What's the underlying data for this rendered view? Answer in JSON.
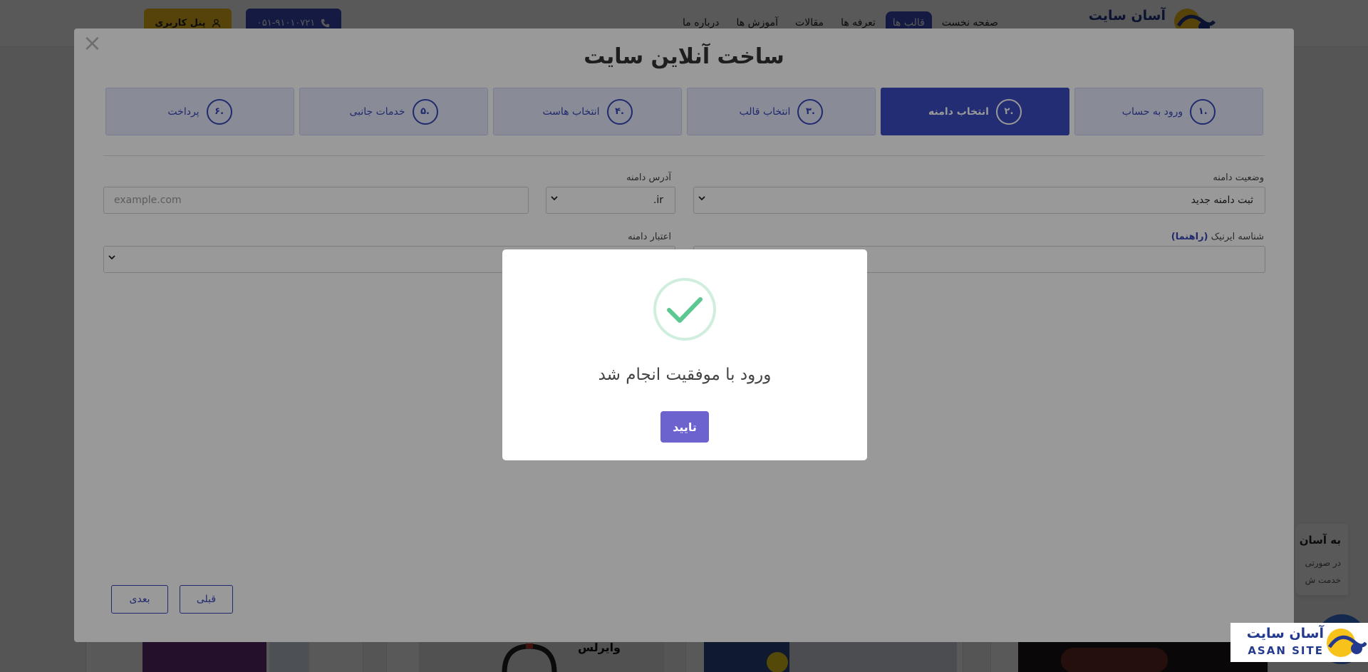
{
  "header": {
    "logo_text": "آسان سایت",
    "nav": [
      "صفحه نخست",
      "قالب ها",
      "تعرفه ها",
      "مقالات",
      "آموزش ها",
      "درباره ما"
    ],
    "active_nav_index": 1,
    "phone": "۰۵۱-۹۱۰۱۰۷۲۱",
    "panel_label": "پنل کاربری"
  },
  "bg_cards": {
    "headphones_caption": "وایرلس"
  },
  "chat_widget": {
    "title": "به آسان",
    "line1": "در صورتی",
    "line2": "خدمت ش"
  },
  "wizard": {
    "close_symbol": "×",
    "title": "ساخت آنلاین سایت",
    "steps": [
      {
        "num": "۱.",
        "label": "ورود به حساب",
        "active": false
      },
      {
        "num": "۲.",
        "label": "انتخاب دامنه",
        "active": true
      },
      {
        "num": "۳.",
        "label": "انتخاب قالب",
        "active": false
      },
      {
        "num": "۴.",
        "label": "انتخاب هاست",
        "active": false
      },
      {
        "num": "۵.",
        "label": "خدمات جانبی",
        "active": false
      },
      {
        "num": "۶.",
        "label": "پرداخت",
        "active": false
      }
    ],
    "form": {
      "domain_status_label": "وضعیت دامنه",
      "domain_status_value": "ثبت دامنه جدید",
      "domain_address_label": "آدرس دامنه",
      "tld_value": ".ir",
      "domain_placeholder": "example.com",
      "irnic_label": "شناسه ایرنیک",
      "irnic_link": "(راهنما)",
      "validity_label": "اعتبار دامنه"
    },
    "buttons": {
      "next": "بعدی",
      "prev": "قبلی"
    }
  },
  "alert": {
    "message": "ورود با موفقیت انجام شد",
    "ok_label": "تایید",
    "icon": "check-icon",
    "success_color": "#5cc891"
  },
  "brand_badge": {
    "fa": "آسان سایت",
    "en": "ASAN SITE"
  },
  "colors": {
    "primary": "#3b4cc0",
    "accent_yellow": "#f7c21a",
    "ok_button": "#6c63cf"
  }
}
